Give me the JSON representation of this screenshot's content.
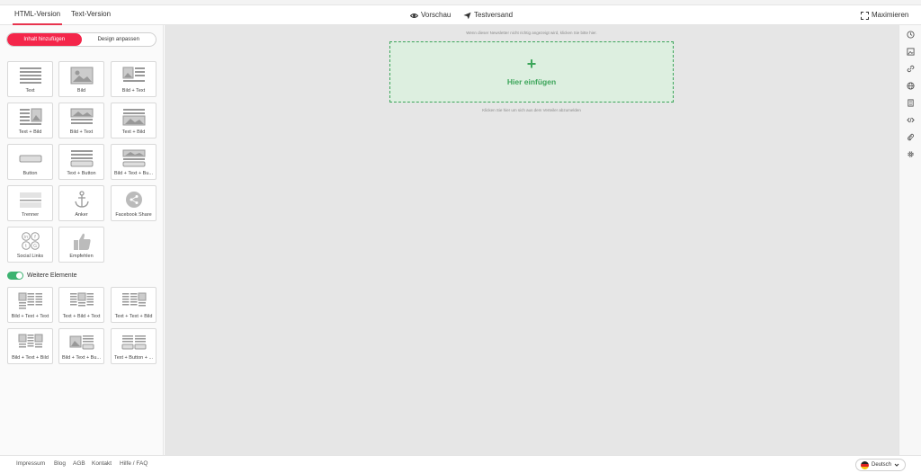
{
  "header": {
    "tabs": [
      {
        "label": "HTML-Version",
        "active": true
      },
      {
        "label": "Text-Version",
        "active": false
      }
    ],
    "preview_label": "Vorschau",
    "test_send_label": "Testversand",
    "maximize_label": "Maximieren"
  },
  "sidebar": {
    "segment": {
      "add_content": "Inhalt hinzufügen",
      "design": "Design anpassen"
    },
    "blocks": [
      {
        "label": "Text",
        "icon": "text-block-icon"
      },
      {
        "label": "Bild",
        "icon": "image-block-icon"
      },
      {
        "label": "Bild + Text",
        "icon": "image-text-block-icon"
      },
      {
        "label": "Text + Bild",
        "icon": "text-image-block-icon"
      },
      {
        "label": "Bild + Text",
        "icon": "image-over-text-block-icon"
      },
      {
        "label": "Text + Bild",
        "icon": "text-over-image-block-icon"
      },
      {
        "label": "Button",
        "icon": "button-block-icon"
      },
      {
        "label": "Text + Button",
        "icon": "text-button-block-icon"
      },
      {
        "label": "Bild + Text + Bu...",
        "icon": "image-text-button-block-icon"
      },
      {
        "label": "Trenner",
        "icon": "divider-block-icon"
      },
      {
        "label": "Anker",
        "icon": "anchor-icon"
      },
      {
        "label": "Facebook Share",
        "icon": "share-icon"
      },
      {
        "label": "Social Links",
        "icon": "social-links-icon"
      },
      {
        "label": "Empfehlen",
        "icon": "thumbs-up-icon"
      }
    ],
    "more_toggle_label": "Weitere Elemente",
    "more_blocks": [
      {
        "label": "Bild + Text + Text",
        "icon": "image-text-text-block-icon"
      },
      {
        "label": "Text + Bild + Text",
        "icon": "text-image-text-block-icon"
      },
      {
        "label": "Text + Text + Bild",
        "icon": "text-text-image-block-icon"
      },
      {
        "label": "Bild + Text + Bild",
        "icon": "image-text-image-block-icon"
      },
      {
        "label": "Bild + Text + Bu...",
        "icon": "image-text-button-columns-icon"
      },
      {
        "label": "Text + Button + ...",
        "icon": "text-button-columns-icon"
      }
    ]
  },
  "canvas": {
    "top_hint": "Wenn dieser Newsletter nicht richtig angezeigt wird, klicken Sie bitte hier.",
    "dropzone_label": "Hier einfügen",
    "bottom_hint": "Klicken Sie hier um sich aus dem Verteiler abzumelden"
  },
  "right_tools": [
    "history-icon",
    "image-icon",
    "link-icon",
    "globe-icon",
    "document-icon",
    "code-icon",
    "attachment-icon",
    "gear-icon"
  ],
  "footer": {
    "links": [
      "Impressum",
      "Blog",
      "AGB",
      "Kontakt",
      "Hilfe / FAQ"
    ],
    "language": "Deutsch"
  },
  "colors": {
    "accent": "#f4264a",
    "success": "#3ca55a",
    "dropzone_bg": "#ddefe0"
  }
}
